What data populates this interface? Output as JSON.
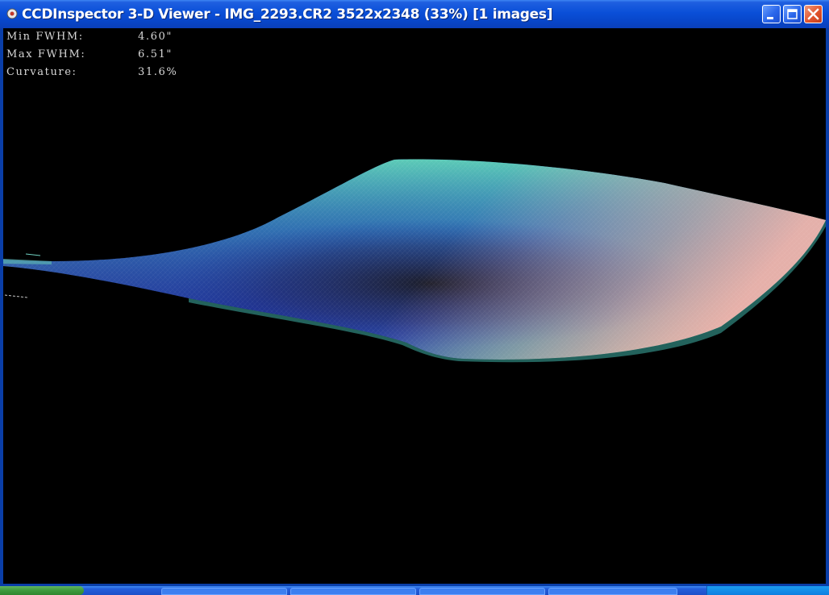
{
  "window": {
    "title": "CCDInspector 3-D Viewer - IMG_2293.CR2 3522x2348 (33%)  [1 images]",
    "app_icon": "ccdinspector-app-icon",
    "buttons": [
      "minimize-icon",
      "maximize-icon",
      "close-icon"
    ]
  },
  "stats": {
    "min_fwhm_label": "Min FWHM:",
    "min_fwhm_value": "4.60\"",
    "max_fwhm_label": "Max FWHM:",
    "max_fwhm_value": "6.51\"",
    "curvature_label": "Curvature:",
    "curvature_value": "31.6%"
  },
  "plot": {
    "type": "3d-surface",
    "color_scale": [
      "#1a1a3a",
      "#1e2f9a",
      "#3a5cc8",
      "#3fb3b3",
      "#f0a0a0"
    ]
  },
  "taskbar": {
    "start_label": "",
    "clock": ""
  }
}
